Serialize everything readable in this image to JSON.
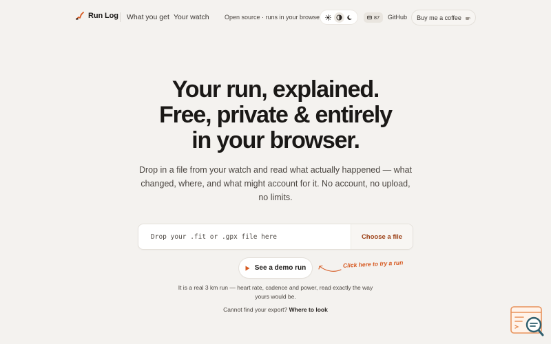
{
  "nav": {
    "brand": "Run Log",
    "brand_icon": "runlog-logo-icon",
    "links": [
      "What you get",
      "Your watch"
    ],
    "tagline": "Open source · runs in your browser",
    "theme_options": [
      {
        "name": "light",
        "icon": "sun-icon"
      },
      {
        "name": "auto",
        "icon": "contrast-icon",
        "active": true
      },
      {
        "name": "dark",
        "icon": "moon-icon"
      }
    ],
    "star_count": "87",
    "github": "GitHub",
    "coffee": "Buy me a coffee"
  },
  "hero": {
    "headline": [
      "Your run, explained.",
      "Free, private & entirely",
      "in your browser."
    ],
    "subtext": "Drop in a file from your watch and read what actually happened — what changed, where, and what might account for it. No account, no upload, no limits."
  },
  "upload": {
    "drop_text": "Drop your .fit or .gpx file here",
    "choose_label": "Choose a file"
  },
  "demo": {
    "button_label": "See a demo run",
    "hint": "Click here to try a run",
    "note": "It is a real 3 km run — heart rate, cadence and power, read exactly the way yours would be."
  },
  "export": {
    "prefix": "Cannot find your export?",
    "link": "Where to look"
  },
  "colors": {
    "background": "#f4f2ef",
    "accent": "#d6581f",
    "accent_dark": "#9a3d12",
    "text": "#1c1a18"
  }
}
